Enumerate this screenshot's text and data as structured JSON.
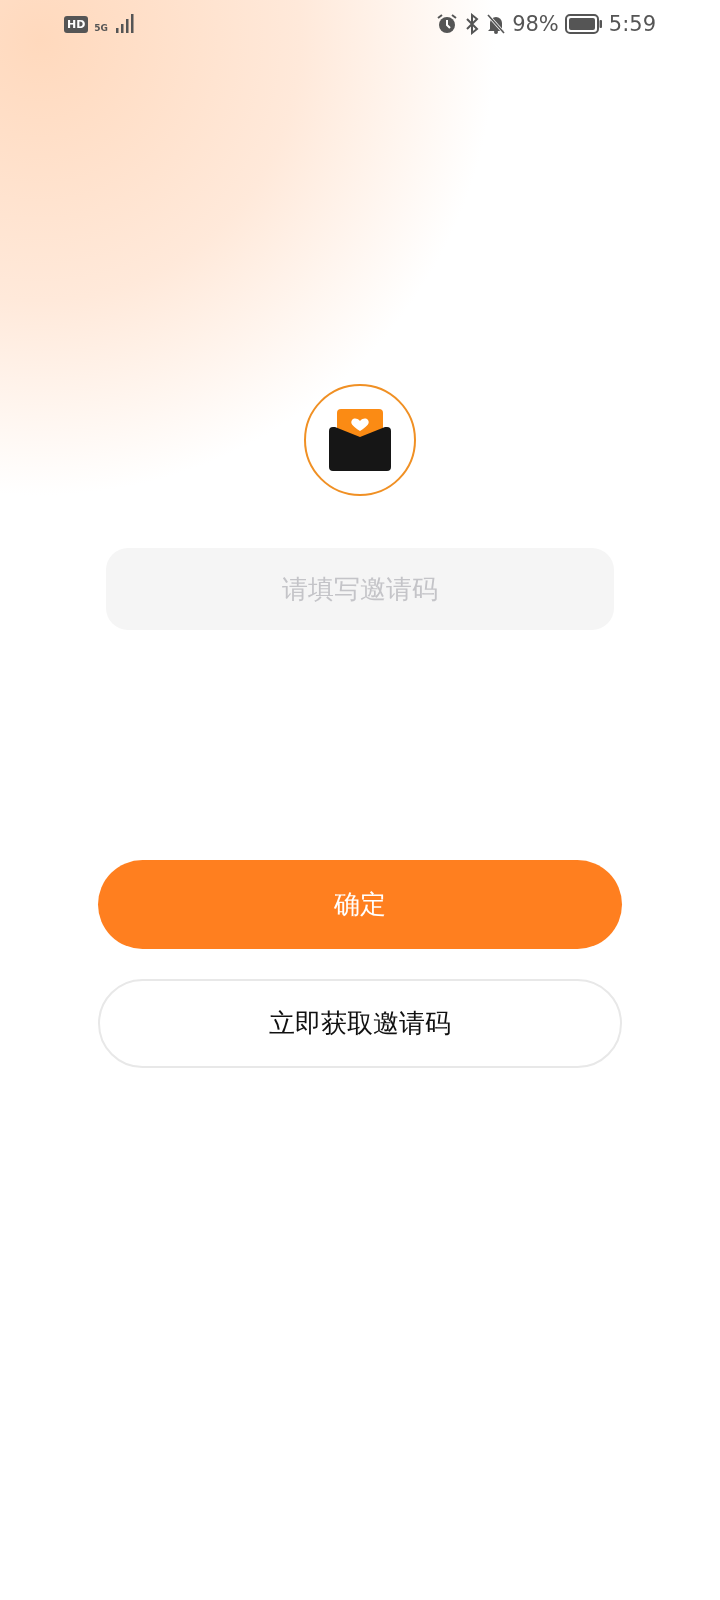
{
  "status_bar": {
    "hd": "HD",
    "network": "5G",
    "battery": "98%",
    "time": "5:59"
  },
  "invite": {
    "placeholder": "请填写邀请码"
  },
  "buttons": [
    {
      "kind": "primary",
      "label": "确定"
    },
    {
      "kind": "outline",
      "label": "立即获取邀请码"
    }
  ]
}
